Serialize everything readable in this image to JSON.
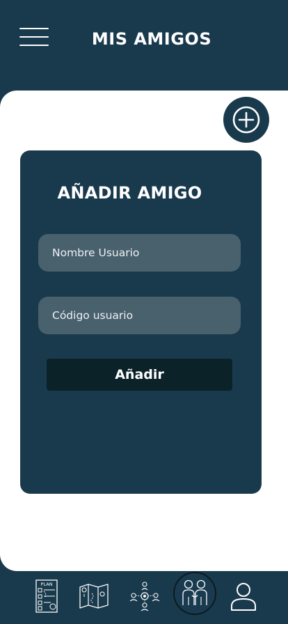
{
  "header": {
    "title": "MIS AMIGOS",
    "menu_icon": "hamburger-menu-icon"
  },
  "fab": {
    "icon": "plus-circle-icon"
  },
  "add_friend_card": {
    "title": "AÑADIR AMIGO",
    "username_placeholder": "Nombre Usuario",
    "username_value": "",
    "code_placeholder": "Código usuario",
    "code_value": "",
    "submit_label": "Añadir"
  },
  "bottom_nav": {
    "items": [
      {
        "icon": "plan-checklist-icon",
        "label_on_icon": "PLAN",
        "active": false
      },
      {
        "icon": "map-icon",
        "active": false
      },
      {
        "icon": "team-network-icon",
        "active": false
      },
      {
        "icon": "friends-icon",
        "active": true
      },
      {
        "icon": "profile-icon",
        "active": false
      }
    ]
  },
  "colors": {
    "primary": "#193a4d",
    "background": "#ffffff",
    "input": "#49606d",
    "button": "#0b2229",
    "text_light": "#ffffff"
  }
}
